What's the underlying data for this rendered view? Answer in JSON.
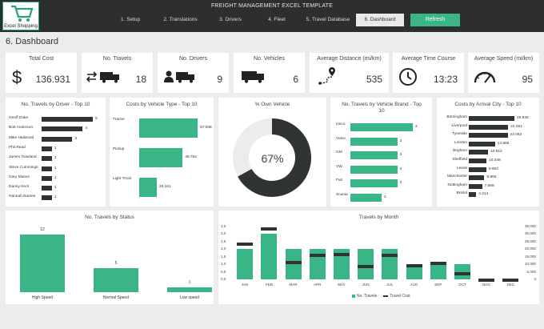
{
  "logo": {
    "text": "Excel Shopping"
  },
  "header": {
    "title": "FREIGHT MANAGEMENT  EXCEL TEMPLATE",
    "tabs": [
      "1. Setup",
      "2. Translations",
      "3. Drivers",
      "4. Fleet",
      "5. Travel Database",
      "6. Dashboard"
    ],
    "refresh": "Refresh"
  },
  "page_title": "6. Dashboard",
  "colors": {
    "accent": "#3ab585",
    "dark": "#2f3432",
    "header_bg": "#2c2f2e"
  },
  "kpis": [
    {
      "label": "Total Cost",
      "value": "136.931",
      "icon": "dollar-icon"
    },
    {
      "label": "No. Travels",
      "value": "18",
      "icon": "arrows-truck-icon"
    },
    {
      "label": "No. Drivers",
      "value": "9",
      "icon": "driver-truck-icon"
    },
    {
      "label": "No. Vehicles",
      "value": "6",
      "icon": "truck-icon"
    },
    {
      "label": "Average Distance (mi/km)",
      "value": "535",
      "icon": "route-icon"
    },
    {
      "label": "Average Time Course",
      "value": "13:23",
      "icon": "clock-icon"
    },
    {
      "label": "Average Speed (mi/km)",
      "value": "95",
      "icon": "speedometer-icon"
    }
  ],
  "chart_data": [
    {
      "type": "bar",
      "orientation": "horizontal",
      "title": "No. Travels by Driver - Top 10",
      "categories": [
        "Geoff Duke",
        "Bob Anderson",
        "Mike Hailwood",
        "Phil Read",
        "James Toseland",
        "Steve Cummings",
        "Gary Mason",
        "Danny Kent",
        "Hannah Barnes"
      ],
      "values": [
        5,
        4,
        3,
        1,
        1,
        1,
        1,
        1,
        1
      ],
      "labels": [
        "5",
        "4",
        "3",
        "1",
        "1",
        "1",
        "1",
        "1",
        "1"
      ]
    },
    {
      "type": "bar",
      "orientation": "horizontal",
      "title": "Costs by Vehicle Type - Top 10",
      "categories": [
        "Tractor",
        "Pickup",
        "Light Truck"
      ],
      "values": [
        67008,
        49762,
        20161
      ],
      "labels": [
        "67.008",
        "49.762",
        "20.161"
      ]
    },
    {
      "type": "pie",
      "title": "% Own Vehicle",
      "values": [
        67,
        33
      ],
      "center_label": "67%"
    },
    {
      "type": "bar",
      "orientation": "horizontal",
      "title": "No. Travels by Vehicle Brand - Top 10",
      "categories": [
        "Iveco",
        "Volvo",
        "GM",
        "VW",
        "Fiat",
        "Scania"
      ],
      "values": [
        4,
        3,
        3,
        3,
        3,
        2
      ],
      "labels": [
        "4",
        "3",
        "3",
        "3",
        "3",
        "2"
      ]
    },
    {
      "type": "bar",
      "orientation": "horizontal",
      "title": "Costs by Arrival City - Top 10",
      "categories": [
        "Birmingham",
        "Liverpool",
        "Tyneside",
        "London",
        "Brighton",
        "Sheffield",
        "Leeds",
        "Manchester",
        "Nottingham",
        "Bristol"
      ],
      "values": [
        25926,
        22351,
        22083,
        14865,
        10912,
        10048,
        9962,
        8866,
        7568,
        4214
      ],
      "labels": [
        "25.926",
        "22.351",
        "22.083",
        "14.865",
        "10.912",
        "10.048",
        "9.962",
        "8.866",
        "7.568",
        "4.214"
      ]
    },
    {
      "type": "bar",
      "title": "No. Travels by Status",
      "categories": [
        "High Speed",
        "Normal Speed",
        "Low speed"
      ],
      "values": [
        12,
        5,
        1
      ],
      "labels": [
        "12",
        "5",
        "1"
      ]
    },
    {
      "type": "bar",
      "title": "Travels by Month",
      "categories": [
        "JAN",
        "FEB",
        "MAR",
        "APR",
        "MAY",
        "JUN",
        "JUL",
        "AUG",
        "SEP",
        "OCT",
        "NOV",
        "DEC"
      ],
      "series": [
        {
          "name": "No. Travels",
          "values": [
            2.0,
            3.0,
            2.0,
            2.0,
            2.0,
            2.0,
            2.0,
            1.0,
            1.0,
            1.0,
            0,
            0
          ]
        },
        {
          "name": "Travel Cost",
          "values": [
            23500,
            33500,
            11500,
            16000,
            16500,
            9000,
            16000,
            9500,
            11000,
            4000,
            0,
            0
          ]
        }
      ],
      "y_ticks": [
        "3,5",
        "3,0",
        "2,5",
        "2,0",
        "1,5",
        "1,0",
        "0,5",
        "0,0"
      ],
      "y2_ticks": [
        "35,000",
        "30,000",
        "25,000",
        "20,000",
        "15,000",
        "10,000",
        "5,000",
        "0"
      ],
      "ylim": [
        0,
        3.5
      ],
      "y2lim": [
        0,
        35000
      ],
      "legend": "bottom"
    }
  ]
}
